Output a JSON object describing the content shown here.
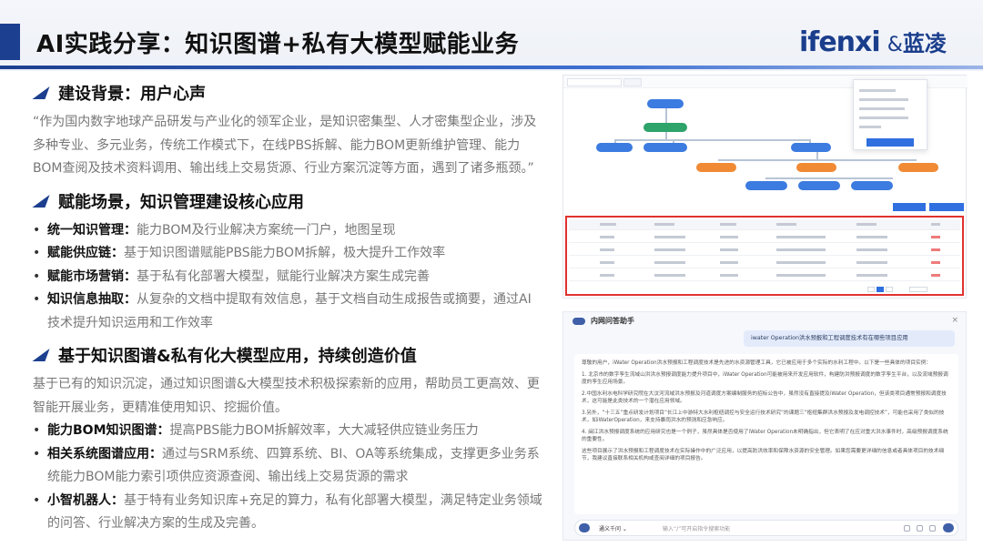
{
  "header": {
    "title": "AI实践分享：知识图谱+私有大模型赋能业务",
    "logo_main": "ifenxi",
    "logo_amp": "&",
    "logo_sub": "蓝凌"
  },
  "sections": {
    "s1": {
      "title": "建设背景：用户心声",
      "text": "“作为国内数字地球产品研发与产业化的领军企业，是知识密集型、人才密集型企业，涉及多种专业、多元业务，传统工作模式下，在线PBS拆解、能力BOM更新维护管理、能力BOM查阅及技术资料调用、输出线上交易货源、行业方案沉淀等方面，遇到了诸多瓶颈。”"
    },
    "s2": {
      "title": "赋能场景，知识管理建设核心应用",
      "items": [
        {
          "bold": "统一知识管理：",
          "text": "能力BOM及行业解决方案统一门户，地图呈现"
        },
        {
          "bold": "赋能供应链：",
          "text": "基于知识图谱赋能PBS能力BOM拆解，极大提升工作效率"
        },
        {
          "bold": "赋能市场营销：",
          "text": "基于私有化部署大模型，赋能行业解决方案生成完善"
        },
        {
          "bold": "知识信息抽取：",
          "text": "从复杂的文档中提取有效信息，基于文档自动生成报告或摘要，通过AI技术提升知识运用和工作效率"
        }
      ]
    },
    "s3": {
      "title": "基于知识图谱&私有化大模型应用，持续创造价值",
      "text": "基于已有的知识沉淀，通过知识图谱&大模型技术积极探索新的应用，帮助员工更高效、更智能开展业务，更精准使用知识、挖掘价值。",
      "items": [
        {
          "bold": "能力BOM知识图谱：",
          "text": "提高PBS能力BOM拆解效率，大大减轻供应链业务压力"
        },
        {
          "bold": "相关系统图谱应用：",
          "text": "通过与SRM系统、四算系统、BI、OA等系统集成，支撑更多业务系统能力BOM能力索引项供应资源查阅、输出线上交易货源的需求"
        },
        {
          "bold": "小智机器人：",
          "text": "基于特有业务知识库+充足的算力，私有化部署大模型，满足特定业务领域的问答、行业解决方案的生成及完善。"
        }
      ]
    }
  },
  "chat": {
    "title": "内网问答助手",
    "close": "×",
    "question": "iwater Operation洪水预报和工程调度技术有在哪些项目应用",
    "answer": [
      "尊敬的用户，iWater Operation洪水预报和工程调度技术是先进的水资源管理工具，它已被应用于多个实际的水利工程中。以下是一些具体的项目实例：",
      "1. 北京市的数字孪生流域山洪洪水预报调度能力提升项目中，iWater Operation可能被用来开发应用软件，构建防洪预报调度的数字孪生平台，以及流域预报调度的孪生应用场景。",
      "2.中国水利水电科学研究院在大汶河流域洪水预报及河道调度方案编制服务的招标公告中，虽然没有直接提及iWater Operation，但该类项目通常预报和调度技术，这可能是此类技术的一个潜在应用领域。",
      "3.另外，“十三五”重点研发计划项目“长江上中游特大水利枢纽调控与安全运行技术研究”的课题三“枢纽集群洪水预报及发电调控技术”，可能也采用了类似的技术，如iWaterOperation，来支持暴雨洪水的预测和应急响应。",
      "4. 闽江洪水预报调度系统的应用研究也是一个例子，虽然具体是否使用了iWater Operation未明确指出，但它表明了在应对重大洪水事件时，高级预报调度系统的重要性。",
      "这些项目展示了洪水预报和工程调度技术在实际操作中的广泛应用，以提高防洪效率和保障水资源的安全管理。如果您需要更详细的信息或者具体项目的技术细节，我建议直接联系相关机构或查阅详细的项目报告。"
    ],
    "input_mode": "通义千问 ⌄",
    "input_placeholder": "输入“/”可开启指令搜索功能"
  }
}
